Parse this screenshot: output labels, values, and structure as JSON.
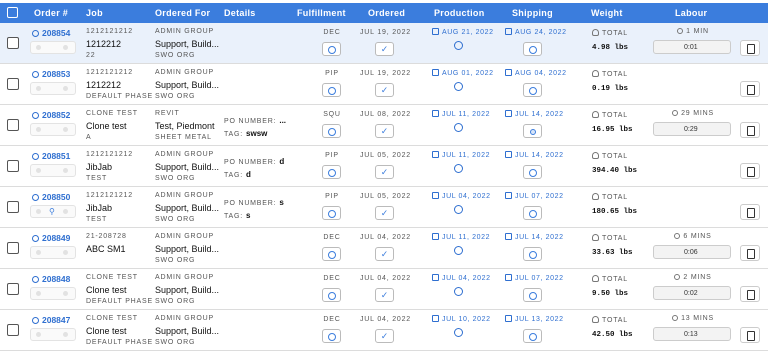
{
  "headers": {
    "order": "Order #",
    "job": "Job",
    "ordered_for": "Ordered For",
    "details": "Details",
    "fulfillment": "Fulfillment",
    "ordered": "Ordered",
    "production": "Production",
    "shipping": "Shipping",
    "weight": "Weight",
    "labour": "Labour"
  },
  "rows": [
    {
      "order": "208854",
      "job_code": "1212121212",
      "job_name": "1212212",
      "job_sub": "22",
      "group": "ADMIN GROUP",
      "for": "Support, Build...",
      "org": "SWO ORG",
      "details_key": "",
      "details_val": "",
      "details_key2": "",
      "details_val2": "",
      "fulfillment": "DEC",
      "ordered": "JUL 19, 2022",
      "production": "AUG 21, 2022",
      "shipping": "AUG 24, 2022",
      "weight_label": "TOTAL",
      "weight": "4.98 lbs",
      "labour_label": "1 MIN",
      "labour_time": "0:01"
    },
    {
      "order": "208853",
      "job_code": "1212121212",
      "job_name": "1212212",
      "job_sub": "DEFAULT PHASE",
      "group": "ADMIN GROUP",
      "for": "Support, Build...",
      "org": "SWO ORG",
      "details_key": "",
      "details_val": "",
      "details_key2": "",
      "details_val2": "",
      "fulfillment": "PIP",
      "ordered": "JUL 19, 2022",
      "production": "AUG 01, 2022",
      "shipping": "AUG 04, 2022",
      "weight_label": "TOTAL",
      "weight": "0.19 lbs",
      "labour_label": "",
      "labour_time": ""
    },
    {
      "order": "208852",
      "job_code": "CLONE TEST",
      "job_name": "Clone test",
      "job_sub": "A",
      "group": "REVIT",
      "for": "Test, Piedmont",
      "org": "SHEET METAL",
      "details_key": "PO NUMBER:",
      "details_val": "...",
      "details_key2": "TAG:",
      "details_val2": "swsw",
      "fulfillment": "SQU",
      "ordered": "JUL 08, 2022",
      "production": "JUL 11, 2022",
      "shipping": "JUL 14, 2022",
      "weight_label": "TOTAL",
      "weight": "16.95 lbs",
      "labour_label": "29 MINS",
      "labour_time": "0:29"
    },
    {
      "order": "208851",
      "job_code": "1212121212",
      "job_name": "JibJab",
      "job_sub": "TEST",
      "group": "ADMIN GROUP",
      "for": "Support, Build...",
      "org": "SWO ORG",
      "details_key": "PO NUMBER:",
      "details_val": "d",
      "details_key2": "TAG:",
      "details_val2": "d",
      "fulfillment": "PIP",
      "ordered": "JUL 05, 2022",
      "production": "JUL 11, 2022",
      "shipping": "JUL 14, 2022",
      "weight_label": "TOTAL",
      "weight": "394.40 lbs",
      "labour_label": "",
      "labour_time": ""
    },
    {
      "order": "208850",
      "job_code": "1212121212",
      "job_name": "JibJab",
      "job_sub": "TEST",
      "group": "ADMIN GROUP",
      "for": "Support, Build...",
      "org": "SWO ORG",
      "details_key": "PO NUMBER:",
      "details_val": "s",
      "details_key2": "TAG:",
      "details_val2": "s",
      "fulfillment": "PIP",
      "ordered": "JUL 05, 2022",
      "production": "JUL 04, 2022",
      "shipping": "JUL 07, 2022",
      "weight_label": "TOTAL",
      "weight": "180.65 lbs",
      "labour_label": "",
      "labour_time": ""
    },
    {
      "order": "208849",
      "job_code": "21-208728",
      "job_name": "ABC SM1",
      "job_sub": "",
      "group": "ADMIN GROUP",
      "for": "Support, Build...",
      "org": "SWO ORG",
      "details_key": "",
      "details_val": "",
      "details_key2": "",
      "details_val2": "",
      "fulfillment": "DEC",
      "ordered": "JUL 04, 2022",
      "production": "JUL 11, 2022",
      "shipping": "JUL 14, 2022",
      "weight_label": "TOTAL",
      "weight": "33.63 lbs",
      "labour_label": "6 MINS",
      "labour_time": "0:06"
    },
    {
      "order": "208848",
      "job_code": "CLONE TEST",
      "job_name": "Clone test",
      "job_sub": "DEFAULT PHASE",
      "group": "ADMIN GROUP",
      "for": "Support, Build...",
      "org": "SWO ORG",
      "details_key": "",
      "details_val": "",
      "details_key2": "",
      "details_val2": "",
      "fulfillment": "DEC",
      "ordered": "JUL 04, 2022",
      "production": "JUL 04, 2022",
      "shipping": "JUL 07, 2022",
      "weight_label": "TOTAL",
      "weight": "9.50 lbs",
      "labour_label": "2 MINS",
      "labour_time": "0:02"
    },
    {
      "order": "208847",
      "job_code": "CLONE TEST",
      "job_name": "Clone test",
      "job_sub": "DEFAULT PHASE",
      "group": "ADMIN GROUP",
      "for": "Support, Build...",
      "org": "SWO ORG",
      "details_key": "",
      "details_val": "",
      "details_key2": "",
      "details_val2": "",
      "fulfillment": "DEC",
      "ordered": "JUL 04, 2022",
      "production": "JUL 10, 2022",
      "shipping": "JUL 13, 2022",
      "weight_label": "TOTAL",
      "weight": "42.50 lbs",
      "labour_label": "13 MINS",
      "labour_time": "0:13"
    }
  ]
}
